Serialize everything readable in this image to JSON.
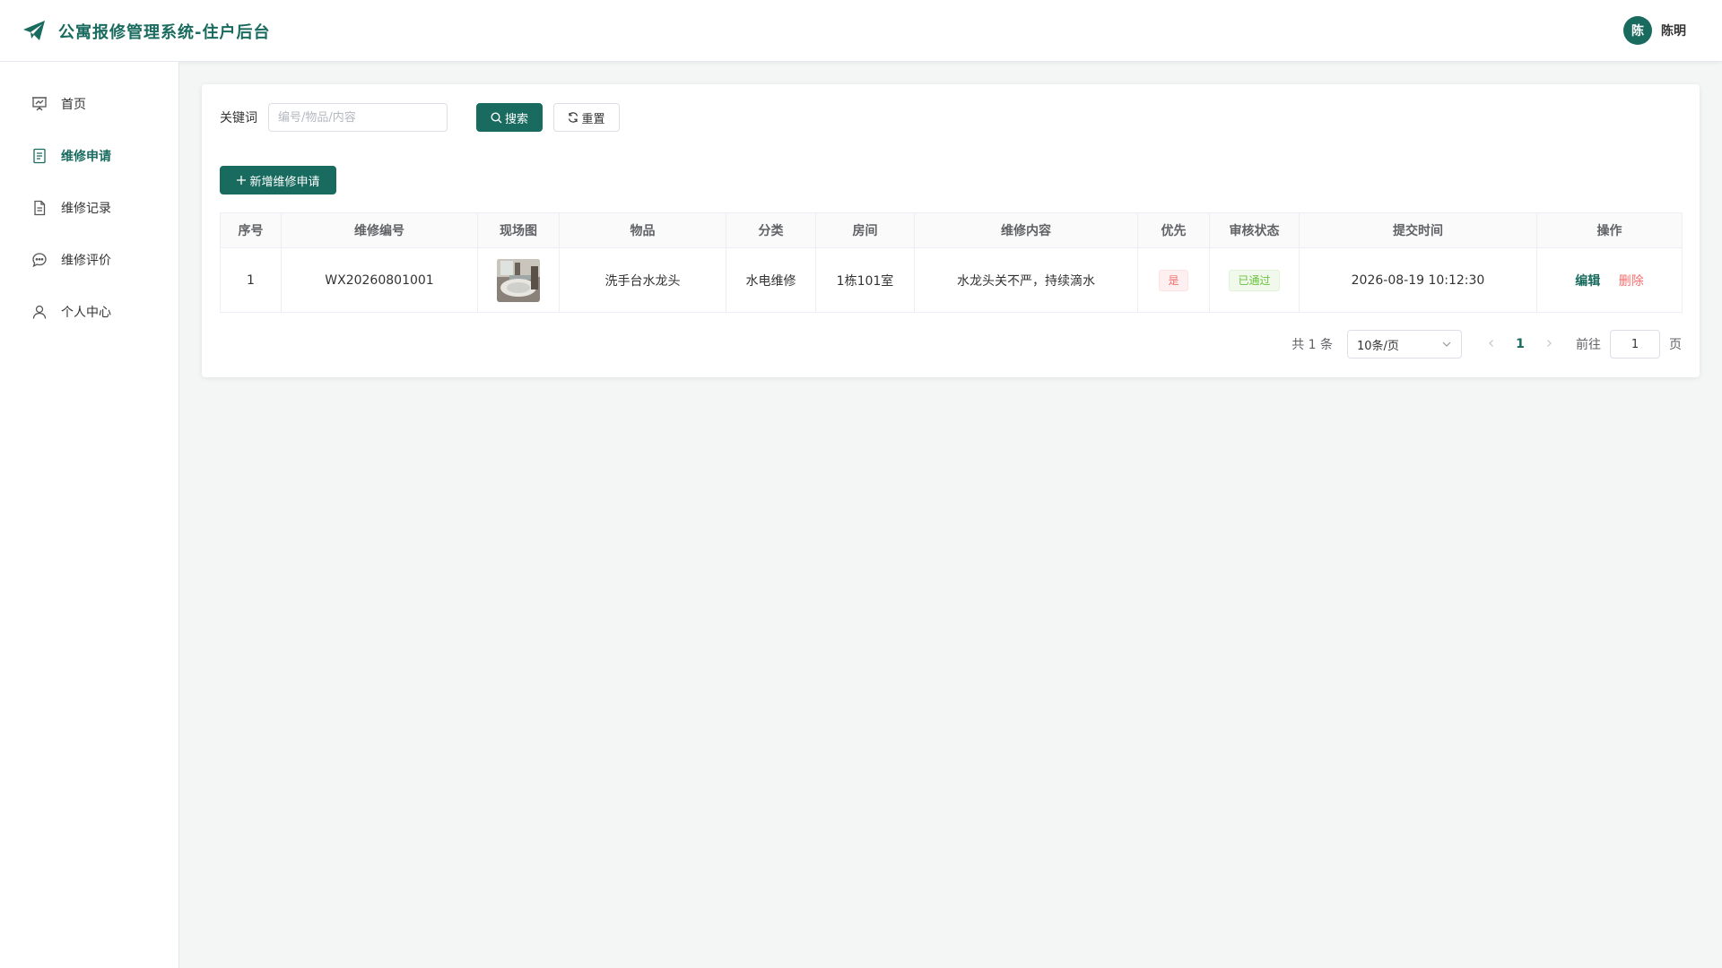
{
  "header": {
    "title": "公寓报修管理系统-住户后台",
    "avatar_text": "陈",
    "username": "陈明"
  },
  "sidebar": {
    "items": [
      {
        "label": "首页",
        "icon": "presentation-chart-icon",
        "active": false
      },
      {
        "label": "维修申请",
        "icon": "document-list-icon",
        "active": true
      },
      {
        "label": "维修记录",
        "icon": "document-icon",
        "active": false
      },
      {
        "label": "维修评价",
        "icon": "chat-bubble-icon",
        "active": false
      },
      {
        "label": "个人中心",
        "icon": "user-icon",
        "active": false
      }
    ]
  },
  "filter": {
    "keyword_label": "关键词",
    "keyword_value": "",
    "keyword_placeholder": "编号/物品/内容",
    "search_label": "搜索",
    "reset_label": "重置"
  },
  "toolbar": {
    "add_label": "新增维修申请"
  },
  "table": {
    "columns": [
      "序号",
      "维修编号",
      "现场图",
      "物品",
      "分类",
      "房间",
      "维修内容",
      "优先",
      "审核状态",
      "提交时间",
      "操作"
    ],
    "rows": [
      {
        "index": "1",
        "code": "WX20260801001",
        "item": "洗手台水龙头",
        "category": "水电维修",
        "room": "1栋101室",
        "content": "水龙头关不严，持续滴水",
        "priority": "是",
        "status": "已通过",
        "submit_time": "2026-08-19 10:12:30",
        "edit_label": "编辑",
        "delete_label": "删除"
      }
    ]
  },
  "pagination": {
    "total_text": "共 1 条",
    "page_size": "10条/页",
    "current_page": "1",
    "goto_label": "前往",
    "goto_value": "1",
    "page_suffix": "页"
  },
  "colors": {
    "accent": "#1a6b5f",
    "danger": "#f56c6c",
    "success": "#67c23a"
  }
}
